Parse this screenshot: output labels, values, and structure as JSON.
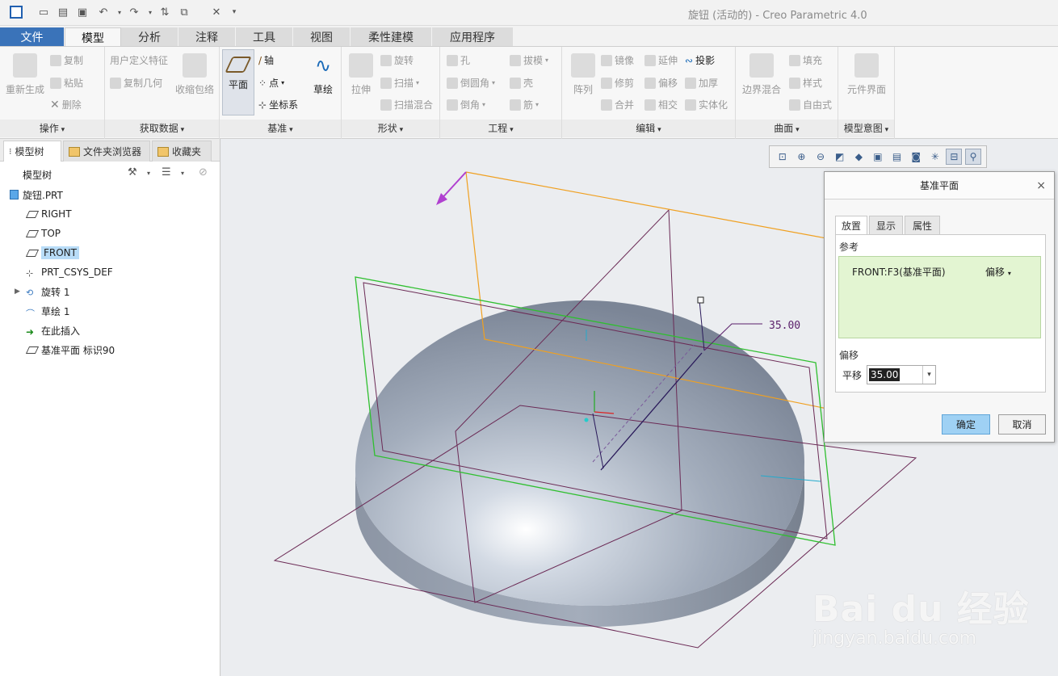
{
  "window": {
    "title": "旋钮 (活动的) - Creo Parametric 4.0"
  },
  "menu": {
    "tabs": [
      "文件",
      "模型",
      "分析",
      "注释",
      "工具",
      "视图",
      "柔性建模",
      "应用程序"
    ]
  },
  "ribbon": {
    "groups": {
      "operations": "操作",
      "get_data": "获取数据",
      "datum": "基准",
      "shapes": "形状",
      "engineering": "工程",
      "edit": "编辑",
      "surface": "曲面",
      "model_intent": "模型意图"
    },
    "items": {
      "regenerate": "重新生成",
      "copy": "复制",
      "paste": "粘贴",
      "delete": "删除",
      "udf": "用户定义特征",
      "copy_geometry": "复制几何",
      "shrinkwrap": "收缩包络",
      "plane": "平面",
      "axis": "轴",
      "point": "点",
      "csys": "坐标系",
      "sketch": "草绘",
      "extrude": "拉伸",
      "revolve": "旋转",
      "sweep": "扫描",
      "swept_blend": "扫描混合",
      "hole": "孔",
      "round": "倒圆角",
      "chamfer": "倒角",
      "draft": "拔模",
      "shell": "壳",
      "rib": "筋",
      "pattern": "阵列",
      "mirror": "镜像",
      "extend": "延伸",
      "project": "投影",
      "trim": "修剪",
      "offset": "偏移",
      "thicken": "加厚",
      "merge": "合并",
      "intersect": "相交",
      "solidify": "实体化",
      "boundary_blend": "边界混合",
      "fill": "填充",
      "style": "样式",
      "freestyle": "自由式",
      "component_interface": "元件界面"
    }
  },
  "left_panel": {
    "tabs": [
      "模型树",
      "文件夹浏览器",
      "收藏夹"
    ],
    "tree_title": "模型树",
    "nodes": [
      {
        "label": "旋钮.PRT",
        "icon": "part-icon"
      },
      {
        "label": "RIGHT",
        "icon": "datum-plane-icon"
      },
      {
        "label": "TOP",
        "icon": "datum-plane-icon"
      },
      {
        "label": "FRONT",
        "icon": "datum-plane-icon",
        "selected": true
      },
      {
        "label": "PRT_CSYS_DEF",
        "icon": "csys-icon"
      },
      {
        "label": "旋转 1",
        "icon": "revolve-icon",
        "expandable": true
      },
      {
        "label": "草绘 1",
        "icon": "sketch-icon"
      },
      {
        "label": "在此插入",
        "icon": "insert-arrow-icon"
      },
      {
        "label": "基准平面 标识90",
        "icon": "datum-plane-icon"
      }
    ]
  },
  "viewport": {
    "dimension_value": "35.00"
  },
  "dialog": {
    "title": "基准平面",
    "tabs": [
      "放置",
      "显示",
      "属性"
    ],
    "references_label": "参考",
    "reference": "FRONT:F3(基准平面)",
    "reference_mode": "偏移",
    "offset_label": "偏移",
    "translate_label": "平移",
    "translate_value": "35.00",
    "ok": "确定",
    "cancel": "取消"
  },
  "watermark": {
    "brand": "Bai du 经验",
    "url": "jingyan.baidu.com"
  },
  "colors": {
    "file_tab": "#3a73b9",
    "selection": "#b8dcf7",
    "reference_list": "#e3f5d2",
    "ok_button": "#9fd1f4",
    "new_plane": "#2fbf2f",
    "datum_frame": "#f0a020",
    "dimension": "#5a1f6a"
  }
}
